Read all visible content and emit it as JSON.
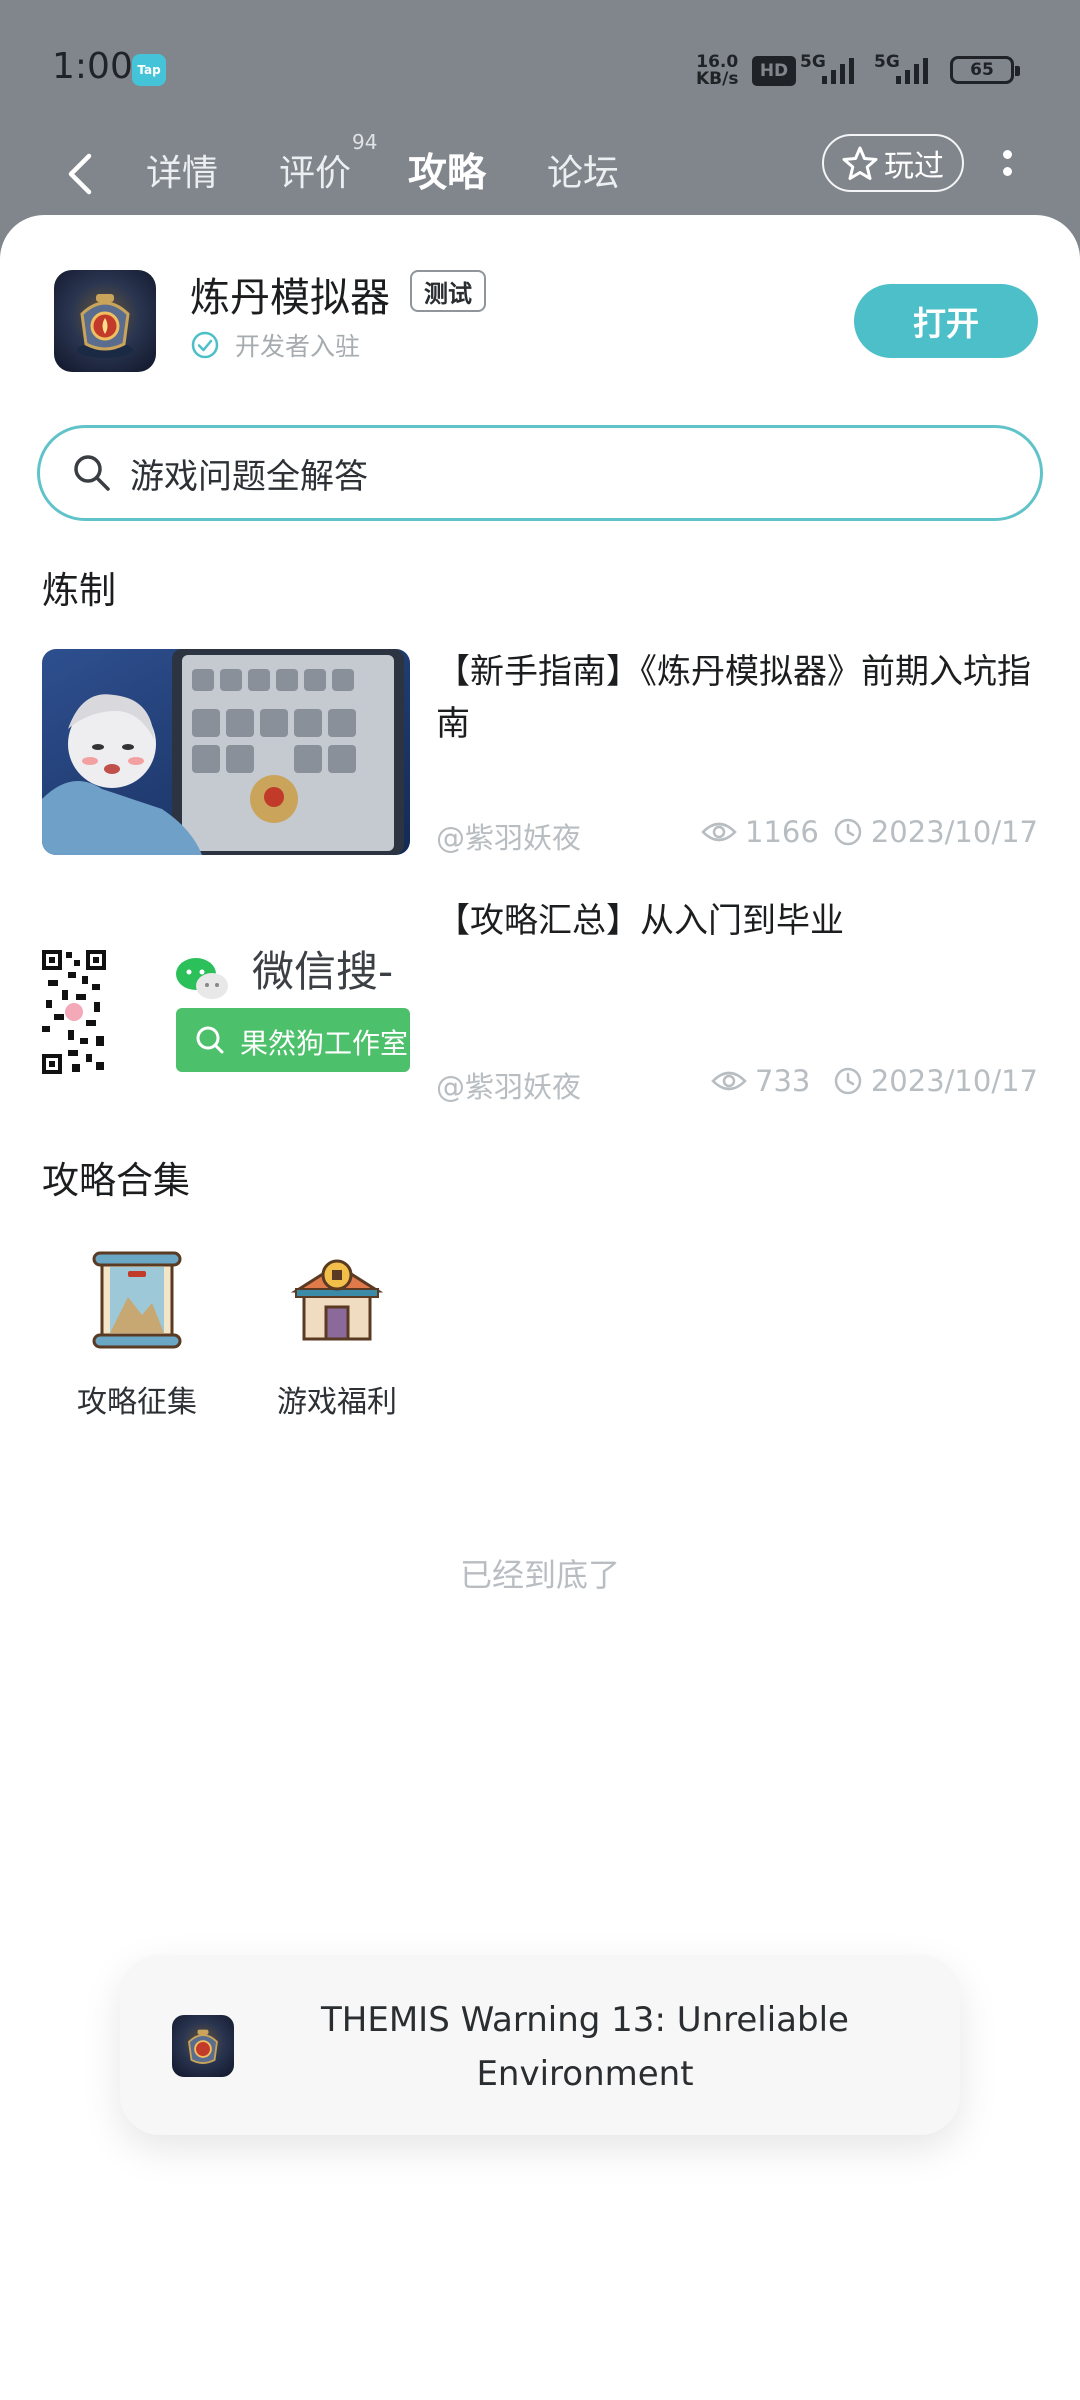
{
  "status_bar": {
    "time": "1:00",
    "tap_badge": "Tap",
    "net_speed_value": "16.0",
    "net_speed_unit": "KB/s",
    "hd": "HD",
    "sim1": "5G",
    "sim2": "5G",
    "battery": "65"
  },
  "nav": {
    "tabs": [
      {
        "label": "详情"
      },
      {
        "label": "评价",
        "badge": "94"
      },
      {
        "label": "攻略"
      },
      {
        "label": "论坛"
      }
    ],
    "played_label": "玩过"
  },
  "app": {
    "title": "炼丹模拟器",
    "badge": "测试",
    "developer": "开发者入驻",
    "open_label": "打开"
  },
  "search": {
    "placeholder": "游戏问题全解答"
  },
  "sections": {
    "guides_title": "炼制",
    "collections_title": "攻略合集"
  },
  "guides": [
    {
      "title": "【新手指南】《炼丹模拟器》前期入坑指南",
      "author": "@紫羽妖夜",
      "views": "1166",
      "date": "2023/10/17"
    },
    {
      "title": "【攻略汇总】从入门到毕业",
      "author": "@紫羽妖夜",
      "views": "733",
      "date": "2023/10/17",
      "thumb_text": "微信搜-",
      "thumb_button": "果然狗工作室"
    }
  ],
  "collections": [
    {
      "label": "攻略征集",
      "icon": "scroll-icon"
    },
    {
      "label": "游戏福利",
      "icon": "shop-icon"
    }
  ],
  "end_text": "已经到底了",
  "toast": {
    "message": "THEMIS Warning 13: Unreliable Environment"
  },
  "colors": {
    "accent": "#4cbfc9",
    "header_bg": "#80868b",
    "meta_gray": "#b8bdc1"
  }
}
